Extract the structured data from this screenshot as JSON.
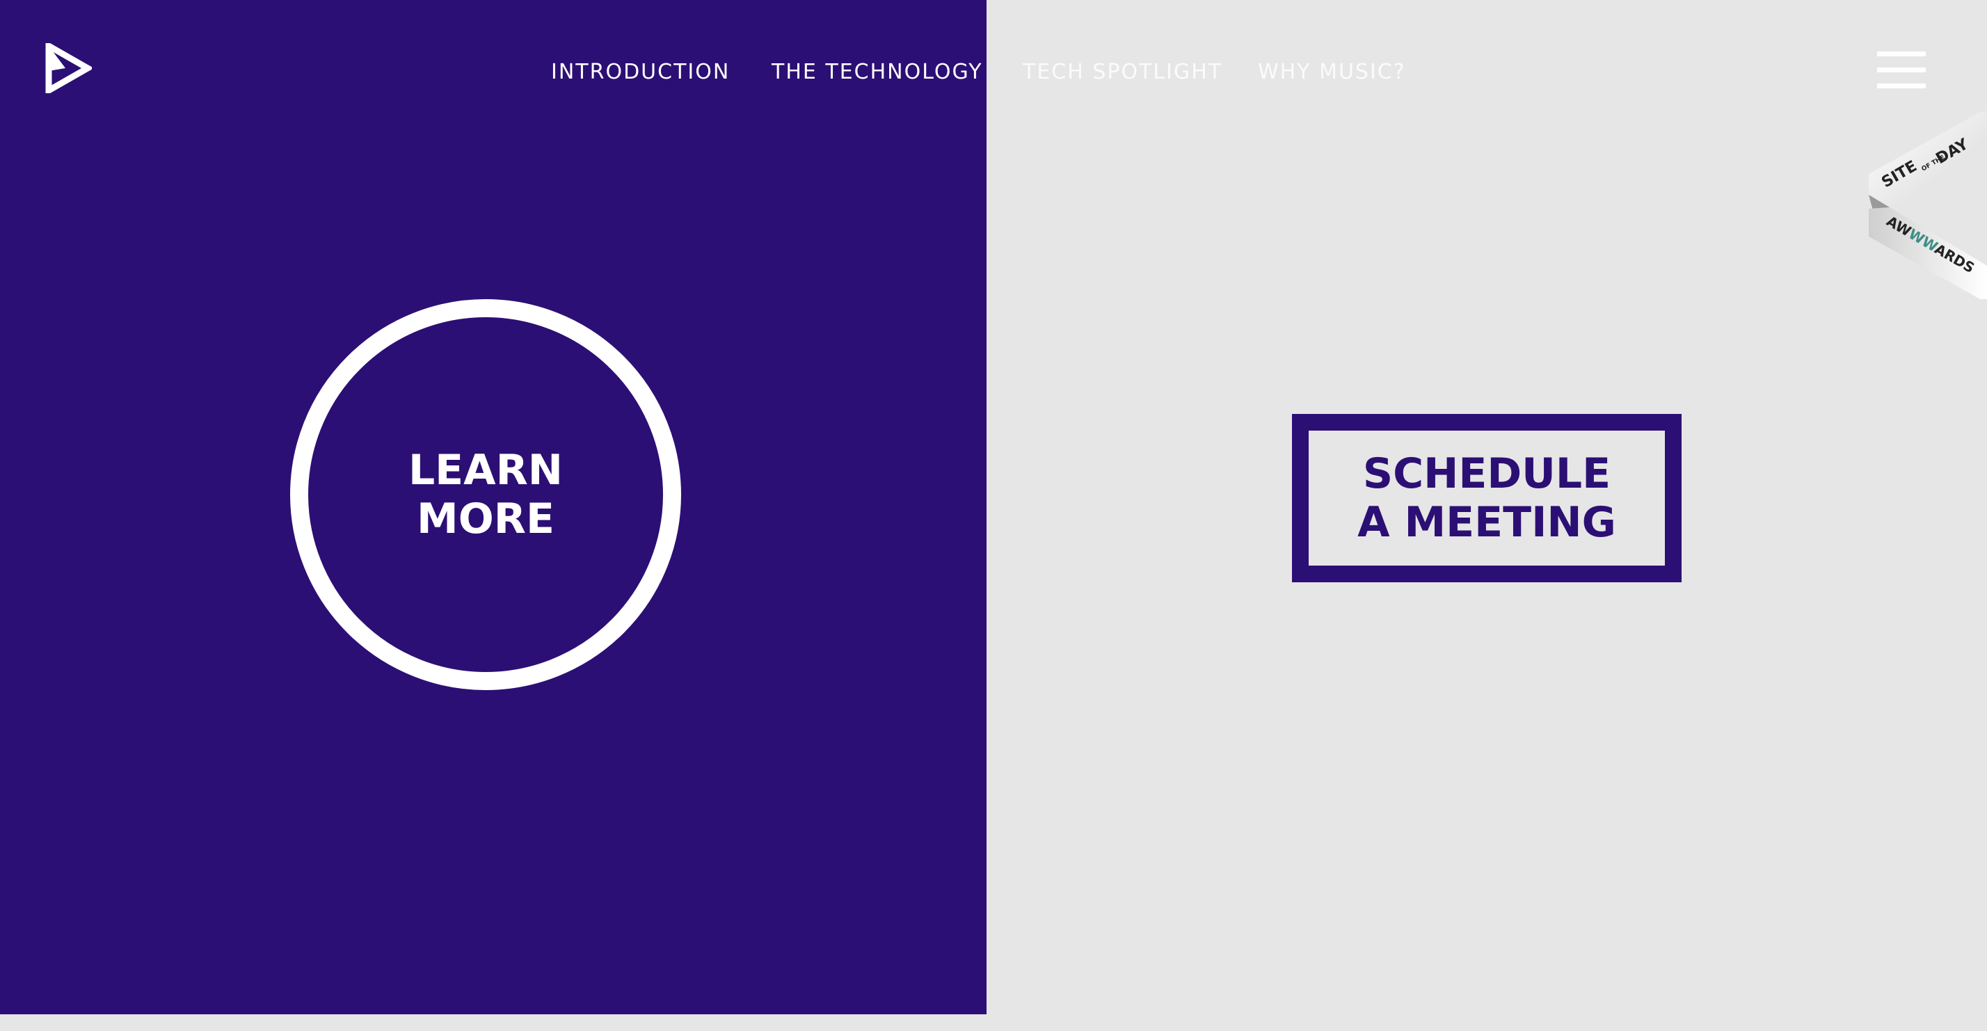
{
  "nav": {
    "items": [
      {
        "label": "INTRODUCTION"
      },
      {
        "label": "THE TECHNOLOGY"
      },
      {
        "label": "TECH SPOTLIGHT"
      },
      {
        "label": "WHY MUSIC?"
      }
    ]
  },
  "hero": {
    "learn_more_line1": "LEARN",
    "learn_more_line2": "MORE",
    "schedule_line1": "SCHEDULE",
    "schedule_line2": "A MEETING"
  },
  "badge": {
    "line1": "SITE",
    "of_the": "OF THE",
    "line2": "DAY",
    "brand": "AWWWARDS"
  },
  "icons": {
    "logo": "play-triangle-logo",
    "menu": "hamburger-menu-icon"
  },
  "colors": {
    "brand_purple": "#2c0f74",
    "light_gray": "#e6e6e6",
    "white": "#ffffff"
  }
}
